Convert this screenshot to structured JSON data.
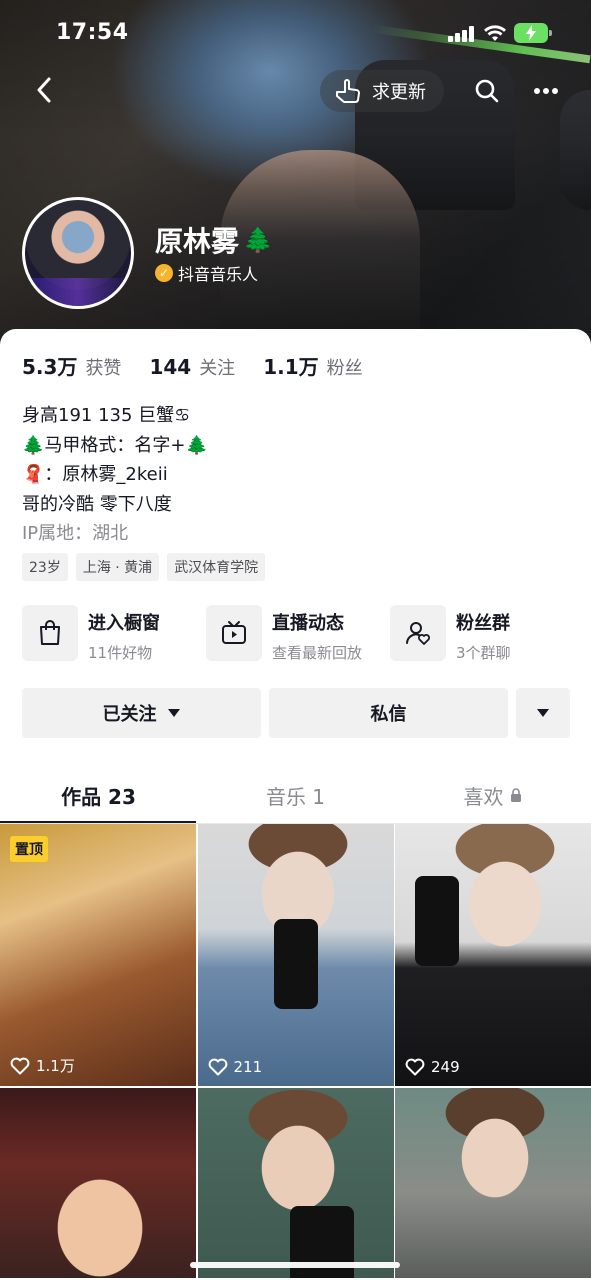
{
  "status_bar": {
    "time": "17:54"
  },
  "header": {
    "update_label": "求更新",
    "name": "原林雾",
    "name_emoji": "🌲",
    "verified_label": "抖音音乐人"
  },
  "stats": [
    {
      "value": "5.3万",
      "label": "获赞"
    },
    {
      "value": "144",
      "label": "关注"
    },
    {
      "value": "1.1万",
      "label": "粉丝"
    }
  ],
  "bio": {
    "lines": [
      "身高191 135 巨蟹♋",
      "🌲马甲格式：名字+🌲",
      "🧣：原林雾_2keii",
      "哥的冷酷 零下八度"
    ],
    "ip": "IP属地：湖北"
  },
  "tags": [
    "23岁",
    "上海 · 黄浦",
    "武汉体育学院"
  ],
  "shortcuts": [
    {
      "title": "进入橱窗",
      "sub": "11件好物",
      "icon": "shopping-bag-icon"
    },
    {
      "title": "直播动态",
      "sub": "查看最新回放",
      "icon": "tv-icon"
    },
    {
      "title": "粉丝群",
      "sub": "3个群聊",
      "icon": "fan-group-icon"
    }
  ],
  "actions": {
    "follow": "已关注",
    "message": "私信"
  },
  "tabs": [
    {
      "label": "作品 23"
    },
    {
      "label": "音乐 1"
    },
    {
      "label": "喜欢"
    }
  ],
  "videos": [
    {
      "pinned": "置顶",
      "likes": "1.1万"
    },
    {
      "likes": "211"
    },
    {
      "likes": "249"
    },
    {
      "likes": ""
    },
    {
      "likes": ""
    },
    {
      "likes": ""
    }
  ],
  "colors": {
    "accent_green": "#6be063",
    "pin_yellow": "#fbce2b",
    "verify_gold": "#f6b52d"
  }
}
